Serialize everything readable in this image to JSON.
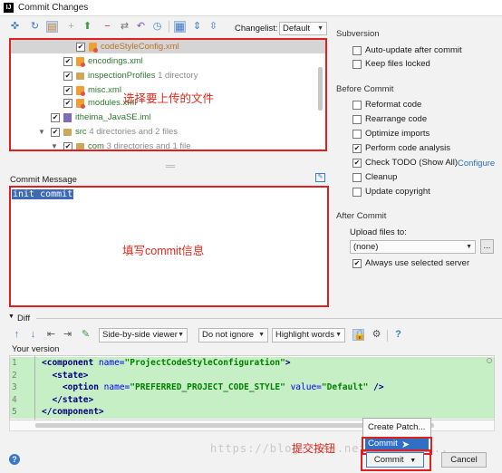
{
  "window": {
    "title": "Commit Changes"
  },
  "toolbar": {
    "changelist_label": "Changelist:",
    "changelist_value": "Default"
  },
  "tree": {
    "rows": [
      {
        "name": "codeStyleConfig.xml",
        "info": ""
      },
      {
        "name": "encodings.xml",
        "info": ""
      },
      {
        "name": "inspectionProfiles",
        "info": "1 directory"
      },
      {
        "name": "misc.xml",
        "info": ""
      },
      {
        "name": "modules.xml",
        "info": ""
      },
      {
        "name": "itheima_JavaSE.iml",
        "info": ""
      },
      {
        "name": "src",
        "info": "4 directories and 2 files"
      },
      {
        "name": "com",
        "info": "3 directories and 1 file"
      }
    ],
    "annotation": "选择要上传的文件"
  },
  "commit_message": {
    "label": "Commit Message",
    "text": "init commit",
    "annotation": "填写commit信息"
  },
  "right_panel": {
    "subversion_title": "Subversion",
    "subversion_options": [
      {
        "label": "Auto-update after commit",
        "checked": false
      },
      {
        "label": "Keep files locked",
        "checked": false
      }
    ],
    "before_commit_title": "Before Commit",
    "before_commit_options": [
      {
        "label": "Reformat code",
        "checked": false
      },
      {
        "label": "Rearrange code",
        "checked": false
      },
      {
        "label": "Optimize imports",
        "checked": false
      },
      {
        "label": "Perform code analysis",
        "checked": true
      },
      {
        "label": "Check TODO (Show All)",
        "checked": true
      },
      {
        "label": "Cleanup",
        "checked": false
      },
      {
        "label": "Update copyright",
        "checked": false
      }
    ],
    "configure_link": "Configure",
    "after_commit_title": "After Commit",
    "upload_label": "Upload files to:",
    "upload_value": "(none)",
    "more_button": "...",
    "always_use_label": "Always use selected server"
  },
  "diff": {
    "label": "Diff",
    "viewer": "Side-by-side viewer",
    "whitespace": "Do not ignore",
    "highlight": "Highlight words",
    "help": "?",
    "version_label": "Your version",
    "lines": [
      {
        "n": "1",
        "indent": "",
        "parts": [
          [
            "tag",
            "<component "
          ],
          [
            "attr",
            "name="
          ],
          [
            "val",
            "\"ProjectCodeStyleConfiguration\""
          ],
          [
            "tag",
            ">"
          ]
        ]
      },
      {
        "n": "2",
        "indent": "  ",
        "parts": [
          [
            "tag",
            "<state>"
          ]
        ]
      },
      {
        "n": "3",
        "indent": "    ",
        "parts": [
          [
            "tag",
            "<option "
          ],
          [
            "attr",
            "name="
          ],
          [
            "val",
            "\"PREFERRED_PROJECT_CODE_STYLE\""
          ],
          [
            "attr",
            " value="
          ],
          [
            "val",
            "\"Default\""
          ],
          [
            "tag",
            " />"
          ]
        ]
      },
      {
        "n": "4",
        "indent": "  ",
        "parts": [
          [
            "tag",
            "</state>"
          ]
        ]
      },
      {
        "n": "5",
        "indent": "",
        "parts": [
          [
            "tag",
            "</component>"
          ]
        ]
      }
    ]
  },
  "footer": {
    "popup_create_patch": "Create Patch...",
    "popup_commit": "Commit",
    "commit_button": "Commit",
    "cancel_button": "Cancel",
    "annotation": "提交按钮",
    "watermark": "https://blog.csdn.net/qingqin..."
  },
  "colors": {
    "annotation": "#e02020",
    "added_line_bg": "#c7efc5",
    "selection": "#3e6ab3",
    "accent": "#2a6fb8"
  }
}
